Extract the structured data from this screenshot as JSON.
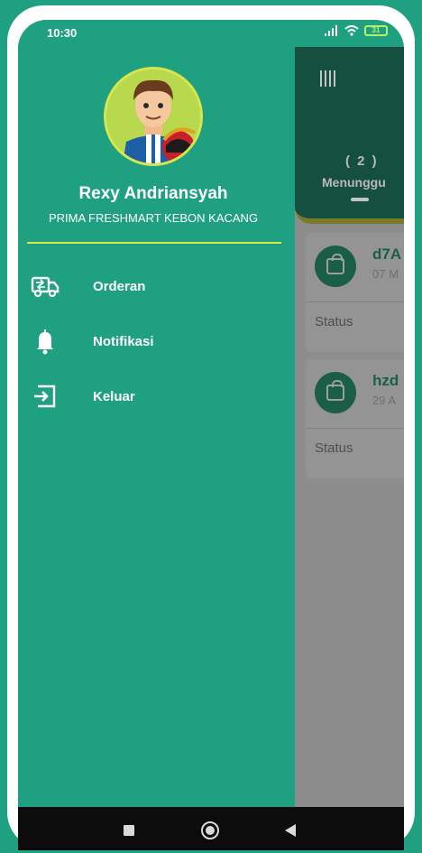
{
  "status_bar": {
    "time": "10:30",
    "battery": "31"
  },
  "drawer": {
    "user_name": "Rexy Andriansyah",
    "store_name": "PRIMA FRESHMART KEBON KACANG",
    "menu": [
      {
        "label": "Orderan",
        "icon": "delivery-truck-icon"
      },
      {
        "label": "Notifikasi",
        "icon": "bell-icon"
      },
      {
        "label": "Keluar",
        "icon": "logout-icon"
      }
    ]
  },
  "main": {
    "tab_count": "( 2 )",
    "tab_label": "Menunggu",
    "orders": [
      {
        "id": "d7A",
        "date": "07 M",
        "status_label": "Status"
      },
      {
        "id": "hzd",
        "date": "29 A",
        "status_label": "Status"
      }
    ]
  },
  "colors": {
    "primary": "#1fa181",
    "accent": "#d6e64c",
    "dark": "#154f3f"
  }
}
